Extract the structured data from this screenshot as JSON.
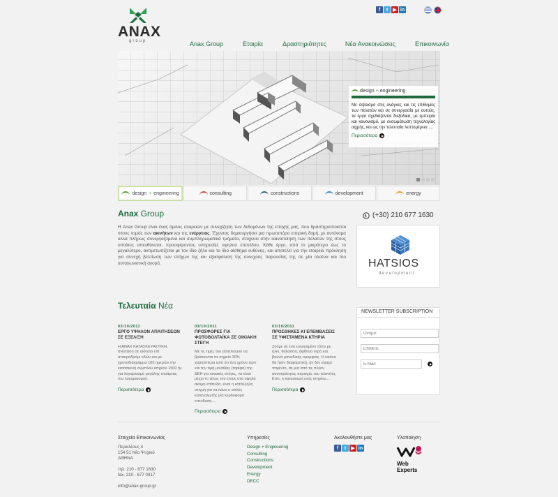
{
  "brand": {
    "name": "ANAX",
    "sub": "group"
  },
  "social_top": [
    "facebook-icon",
    "twitter-icon",
    "youtube-icon",
    "linkedin-icon"
  ],
  "languages": [
    "greek-flag-icon",
    "uk-flag-icon"
  ],
  "nav": {
    "items": [
      "Anax Group",
      "Εταιρία",
      "Δραστηριότητες",
      "Νέα Ανακοινώσεις",
      "Επικοινωνία"
    ]
  },
  "hero": {
    "caption_title_1": "design",
    "caption_title_2": "engineering",
    "caption_text": "Με σεβασμό στις ανάγκες και τις επιθυμίες των πελατών και σε συνεργασία με αυτούς, τα έργα σχεδιάζονται διεξοδικά, με εμπειρία και κανονισμό, με ενσωμάτωση τεχνολογίας αιχμής, και ως την τελευταία λεπτομέρεια ....",
    "more": "Περισσότερα",
    "slides": 4,
    "active_slide": 1
  },
  "tabs": [
    {
      "label": "design",
      "label2": "engineering",
      "color": "#5a9c3a"
    },
    {
      "label": "consulting",
      "color": "#c0504d"
    },
    {
      "label": "constructions",
      "color": "#2b5d6b"
    },
    {
      "label": "development",
      "color": "#3b8fc4"
    },
    {
      "label": "energy",
      "color": "#e6a11f"
    }
  ],
  "about": {
    "title_bold": "Anax",
    "title_rest": " Group",
    "p1": "Η Anax Group είναι ένας όμιλος εταιρειών με συνεχίζηση των δεδομένων της εποχής μας, που δραστηριοποιείται στους τομείς των ",
    "b1": "ακινήτων",
    "p2": " και της ",
    "b2": "ενέργειας",
    "p3": ". Έχοντας δημιουργήσει μια πρωτοπόρο εταιρική δομή, με αυτόνομα αλλά πλήρως συνεργαζόμενα και συμπληρωματικά τμήματα, στοχεύει στην ικανοποίηση των πελατών της στους οποίους απευθύνεται, προσφέροντας υπηρεσίες υψηλού επιπέδου. Κάθε έργο, από το μικρότερο έως το μεγαλύτερο, αντιμετωπίζεται με τον ίδιο ζήλο και το ίδιο αίσθημα ευθύνης, και αποτελεί για την εταιρεία πρόκληση για συνεχή βελτίωση των στόχων της και εξασφάλιση της συνεχούς παρουσίας της σε μία ολοένα και πιο ανταγωνιστική αγορά."
  },
  "phone": "(+30) 210 677 1630",
  "partner": {
    "name": "HATSIOS",
    "sub": "development"
  },
  "news": {
    "title_bold": "Τελευταία",
    "title_rest": " Νέα",
    "items": [
      {
        "date": "03/10/2011",
        "title": "ΕΡΓΟ ΥΨΗΛΟΝ ΑΠΑΙΤΗΣΕΩΝ ΣΕ ΕΞΕΛΙΞΗ",
        "body": "Η ΑΝΑΧ ΚΑΤΑΣΚΕΥΑΣΤΙΚΗ, ανιστάσα σε ακίνητο επί σταυροδρόμι οδών και με χρονοδιάγραμμα 105 ημερών την κατασκευή σύμπλου κτηρίου 1500 τμ για λογαριασμό μεγάλης στοάρτας του λογαριασμού.",
        "more": "Περισσότερα"
      },
      {
        "date": "03/10/2011",
        "title": "ΠΡΟΣΦΟΡΕΣ ΓΙΑ ΦΩΤΟΒΟΛΤΑΪΚΑ ΣΕ ΟΙΚΙΑΚΗ ΣΤΕΓΗ",
        "body": "Με τις τιμές του εξοπλισμού να βρίσκονται σε σημείο 30% χαμηλότερα από ότι ένα χρόνο πριν και την τιμή μονάδας (ταρίφα) της ΔΕΗ για οικιακές στέγες, να είναι μέχρι το τέλος του έτους στα υψηλά ακόμη επίπεδα, είναι η κατάλληλη στιγμή για να κάνει ο απλός καταναλωτής μία κερδοφόρα επένδυση....",
        "more": "Περισσότερα"
      },
      {
        "date": "03/10/2011",
        "title": "ΠΡΟΣΘΗΚΕΣ ΚΙ ΕΠΕΜΒΑΣΕΙΣ ΣΕ ΥΦΙΣΤΑΜΕΝΑ ΚΤΗΡΙΑ",
        "body": "Ζούμε σε ένα ευλογημένο τόπο με ήλιο, θάλασσα, άφθονα νερά και βουνά μοναδικής ομορφιάς. Η εικόνα θα ήταν διαφορετική, αν δεν είχαμε τσιμέντο, σε μια από τις πλέον ασυγκράτητες περιοχές του πλανήτη. Ετσι, η κατασκευή ενός κτηρίου....",
        "more": "Περισσότερα"
      }
    ]
  },
  "newsletter": {
    "title": "NEWSLETTER SUBSCRIPTION",
    "name_ph": "Όνομα:",
    "surname_ph": "Επίθετο:",
    "email_ph": "E-Mail:"
  },
  "footer": {
    "contact_title": "Στοιχεία Επικοινωνίας",
    "addr1": "Περικλέους 4",
    "addr2": "154 51 Νέο Ψυχικό",
    "addr3": "ΑΘΗΝΑ",
    "tel": "τηλ. 210 - 677 1630",
    "fax": "fax. 210 - 677 0417",
    "email": "info@anax-group.gr",
    "services_title": "Υπηρεσίες",
    "services": [
      "Design + Engineering",
      "Consulting",
      "Constructions",
      "Development",
      "Energy",
      "DECC"
    ],
    "follow_title": "Ακολουθήστε μας",
    "impl_title": "Υλοποίηση",
    "impl_name": "Web Experts"
  }
}
